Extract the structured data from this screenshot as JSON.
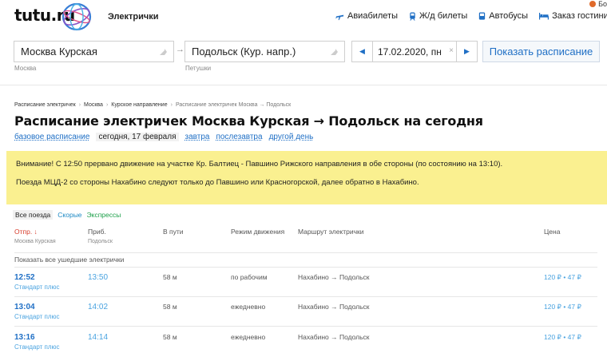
{
  "header": {
    "logo_text": "tutu.ru",
    "section_title": "Электрички",
    "nav": [
      {
        "label": "Авиабилеты",
        "icon": "plane-icon"
      },
      {
        "label": "Ж/д билеты",
        "icon": "train-icon"
      },
      {
        "label": "Автобусы",
        "icon": "bus-icon"
      },
      {
        "label": "Заказ гостиниц",
        "icon": "hotel-icon"
      }
    ],
    "corner_text": "Бо"
  },
  "search": {
    "from_value": "Москва Курская",
    "from_sub": "Москва",
    "to_value": "Подольск (Кур. напр.)",
    "to_sub": "Петушки",
    "date_value": "17.02.2020, пн",
    "submit_label": "Показать расписание"
  },
  "breadcrumbs": [
    "Расписание электричек",
    "Москва",
    "Курское направление",
    "Расписание электричек Москва → Подольск"
  ],
  "page_title": "Расписание электричек Москва Курская → Подольск на сегодня",
  "day_tabs": [
    {
      "label": "базовое расписание",
      "current": false
    },
    {
      "label": "сегодня, 17 февраля",
      "current": true
    },
    {
      "label": "завтра",
      "current": false
    },
    {
      "label": "послезавтра",
      "current": false
    },
    {
      "label": "другой день",
      "current": false
    }
  ],
  "alert": {
    "line1": "Внимание! С 12:50 прервано движение на участке Кр. Балтиец - Павшино Рижского направления в обе стороны (по состоянию на 13:10).",
    "line2": "Поезда МЦД-2 со стороны Нахабино следуют только до Павшино или Красногорской, далее обратно в Нахабино."
  },
  "filters": {
    "all": "Все поезда",
    "fast": "Скорые",
    "express": "Экспрессы"
  },
  "table": {
    "headers": {
      "dep": "Отпр. ↓",
      "dep_sub": "Москва Курская",
      "arr": "Приб.",
      "arr_sub": "Подольск",
      "duration": "В пути",
      "mode": "Режим движения",
      "route": "Маршрут электрички",
      "price": "Цена"
    },
    "show_all": "Показать все ушедшие электрички",
    "rows": [
      {
        "dep": "12:52",
        "cls": "Стандарт плюс",
        "arr": "13:50",
        "dur": "58 м",
        "mode": "по рабочим",
        "route": "Нахабино → Подольск",
        "price": "120 ₽ • 47 ₽"
      },
      {
        "dep": "13:04",
        "cls": "Стандарт плюс",
        "arr": "14:02",
        "dur": "58 м",
        "mode": "ежедневно",
        "route": "Нахабино → Подольск",
        "price": "120 ₽ • 47 ₽"
      },
      {
        "dep": "13:16",
        "cls": "Стандарт плюс",
        "arr": "14:14",
        "dur": "58 м",
        "mode": "ежедневно",
        "route": "Нахабино → Подольск",
        "price": "120 ₽ • 47 ₽"
      }
    ]
  },
  "colors": {
    "link": "#1f6fc5",
    "alert_bg": "#faf090",
    "sort_active": "#d63b2a",
    "express": "#1ea04a"
  }
}
